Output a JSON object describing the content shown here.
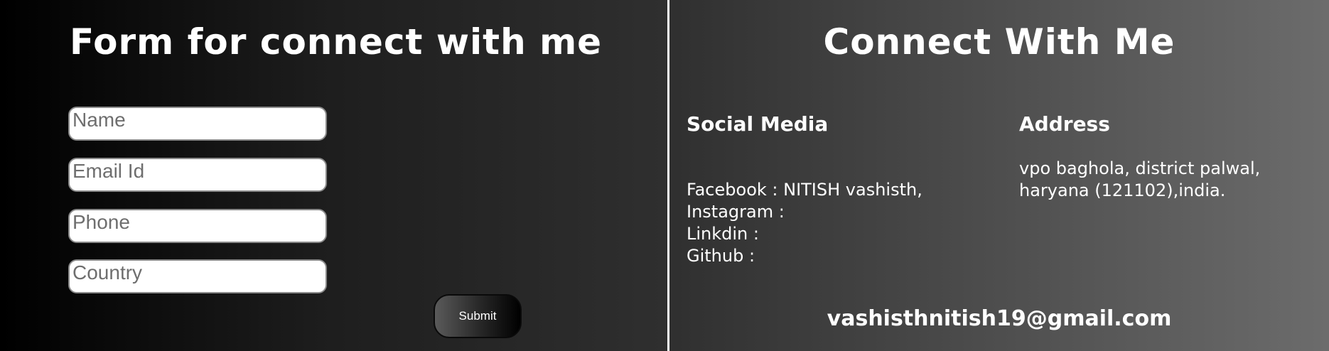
{
  "form": {
    "title": "Form for connect with me",
    "fields": {
      "name": {
        "placeholder": "Name",
        "value": ""
      },
      "email": {
        "placeholder": "Email Id",
        "value": ""
      },
      "phone": {
        "placeholder": "Phone",
        "value": ""
      },
      "country": {
        "placeholder": "Country",
        "value": ""
      }
    },
    "submit_label": "Submit"
  },
  "connect": {
    "title": "Connect With Me",
    "social": {
      "heading": "Social Media",
      "items": [
        "Facebook : NITISH vashisth,",
        "Instagram :",
        "Linkdin :",
        "Github :"
      ]
    },
    "address": {
      "heading": "Address",
      "text": "vpo baghola, district palwal, haryana (121102),india."
    },
    "email": "vashisthnitish19@gmail.com"
  },
  "colors": {
    "text": "#ffffff",
    "divider": "#ffffff",
    "field_background": "#ffffff",
    "field_border": "#8a8a8a"
  }
}
